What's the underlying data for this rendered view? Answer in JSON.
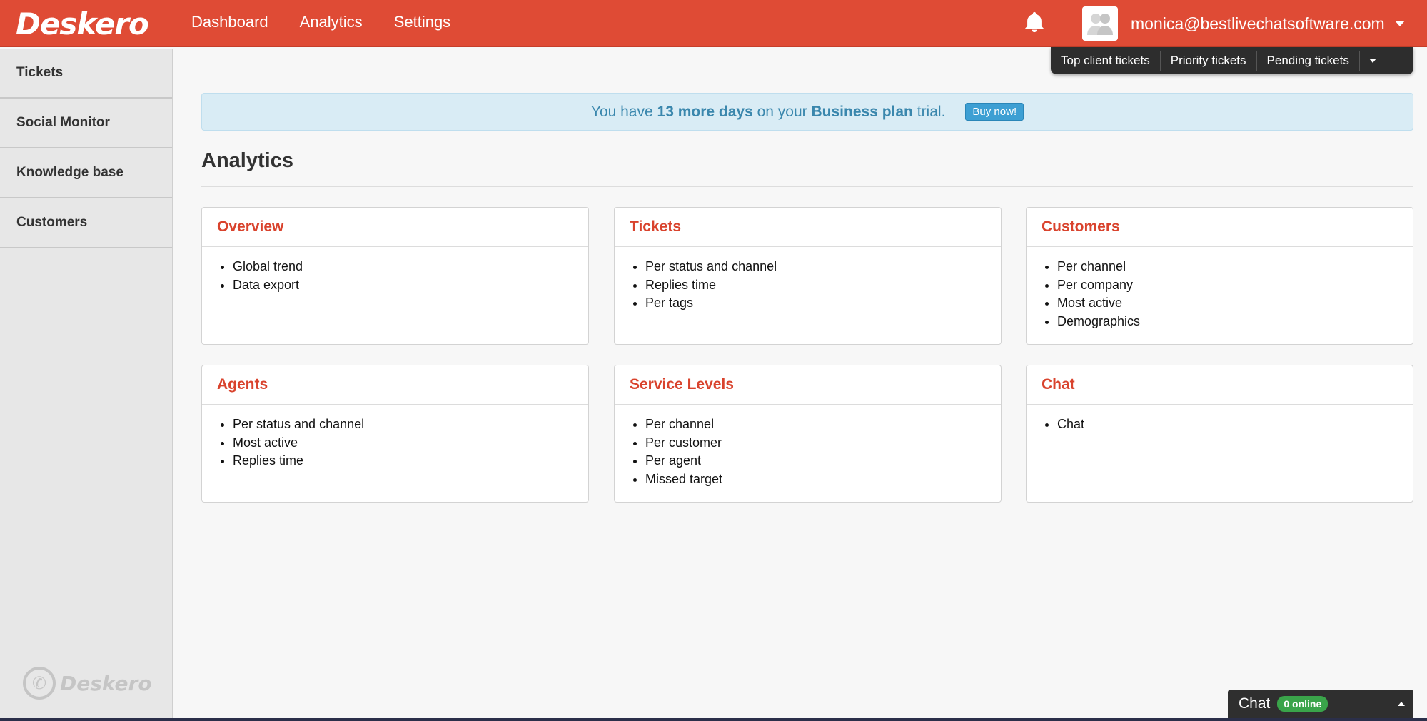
{
  "app": {
    "logo_text": "Deskero",
    "accent_color": "#df4b35"
  },
  "topnav": {
    "items": [
      {
        "label": "Dashboard"
      },
      {
        "label": "Analytics"
      },
      {
        "label": "Settings"
      }
    ]
  },
  "user": {
    "email": "monica@bestlivechatsoftware.com",
    "icons": {
      "notification": "bell-icon",
      "avatar": "user-silhouette-icon",
      "menu": "caret-down-icon"
    }
  },
  "quick_tickets": {
    "items": [
      {
        "label": "Top client tickets"
      },
      {
        "label": "Priority tickets"
      },
      {
        "label": "Pending tickets"
      }
    ]
  },
  "sidebar": {
    "items": [
      {
        "label": "Tickets"
      },
      {
        "label": "Social Monitor"
      },
      {
        "label": "Knowledge base"
      },
      {
        "label": "Customers"
      }
    ],
    "footer_logo": "Deskero"
  },
  "trial": {
    "prefix": "You have",
    "days": "13 more days",
    "middle": "on your",
    "plan": "Business plan",
    "suffix": "trial.",
    "button": "Buy now!"
  },
  "page": {
    "title": "Analytics"
  },
  "cards": [
    {
      "title": "Overview",
      "items": [
        "Global trend",
        "Data export"
      ]
    },
    {
      "title": "Tickets",
      "items": [
        "Per status and channel",
        "Replies time",
        "Per tags"
      ]
    },
    {
      "title": "Customers",
      "items": [
        "Per channel",
        "Per company",
        "Most active",
        "Demographics"
      ]
    },
    {
      "title": "Agents",
      "items": [
        "Per status and channel",
        "Most active",
        "Replies time"
      ]
    },
    {
      "title": "Service Levels",
      "items": [
        "Per channel",
        "Per customer",
        "Per agent",
        "Missed target"
      ]
    },
    {
      "title": "Chat",
      "items": [
        "Chat"
      ]
    }
  ],
  "chat_widget": {
    "label": "Chat",
    "status": "0 online",
    "status_color": "#3aa44a"
  }
}
